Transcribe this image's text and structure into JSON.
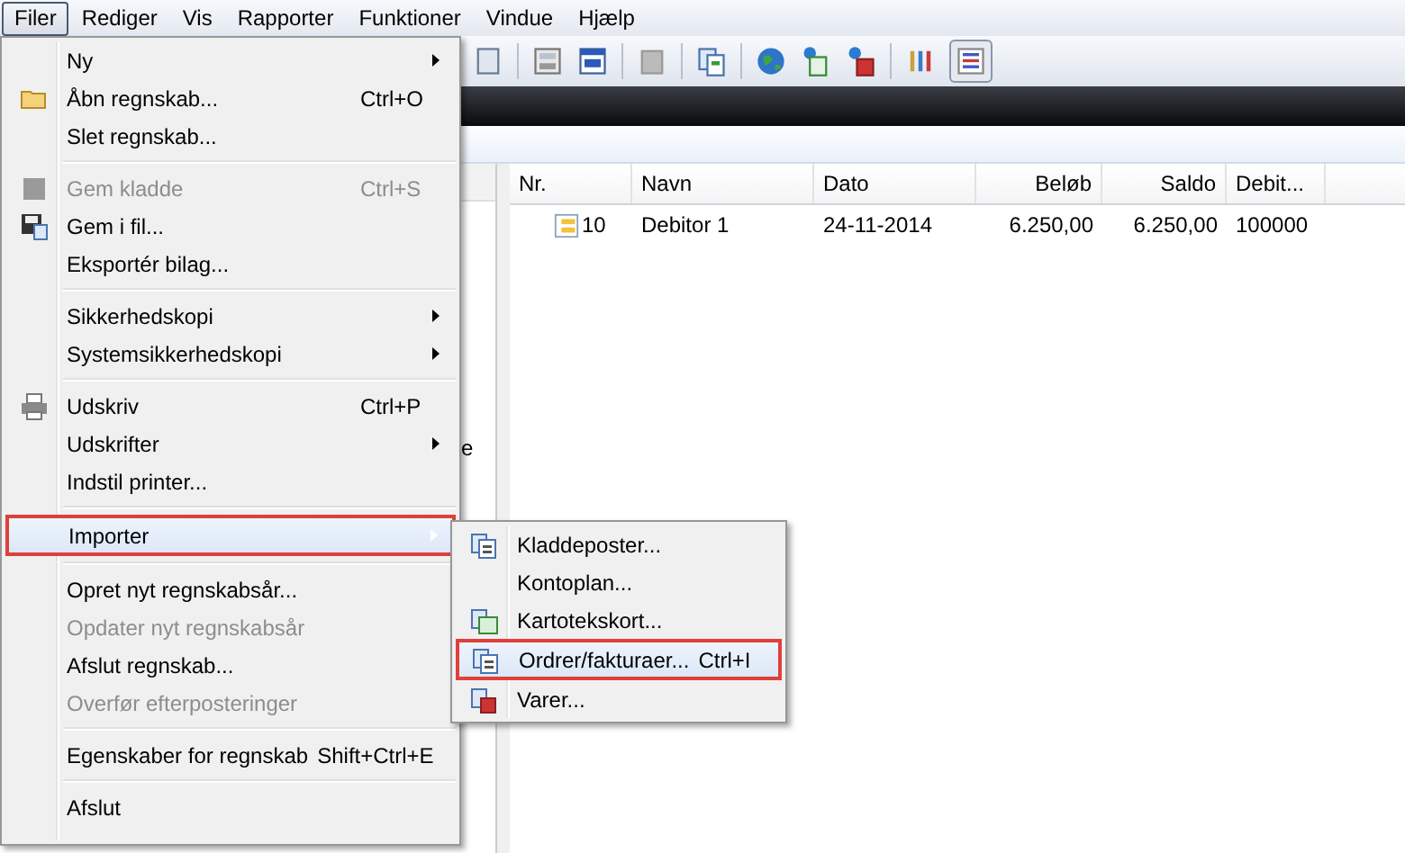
{
  "menu_bar": [
    {
      "label": "Filer",
      "selected": true
    },
    {
      "label": "Rediger",
      "selected": false
    },
    {
      "label": "Vis",
      "selected": false
    },
    {
      "label": "Rapporter",
      "selected": false
    },
    {
      "label": "Funktioner",
      "selected": false
    },
    {
      "label": "Vindue",
      "selected": false
    },
    {
      "label": "Hjælp",
      "selected": false
    }
  ],
  "table": {
    "columns": [
      {
        "label": "Nr."
      },
      {
        "label": "Navn"
      },
      {
        "label": "Dato"
      },
      {
        "label": "Beløb"
      },
      {
        "label": "Saldo"
      },
      {
        "label": "Debit..."
      }
    ],
    "rows": [
      [
        "10",
        "Debitor 1",
        "24-11-2014",
        "6.250,00",
        "6.250,00",
        "100000"
      ]
    ]
  },
  "left_pane": {
    "text_fragment": "e"
  },
  "file_menu": [
    {
      "kind": "item",
      "label": "Ny",
      "disabled": false,
      "submenu": true,
      "highlighted": false
    },
    {
      "kind": "item",
      "label": "Åbn regnskab...",
      "shortcut": "Ctrl+O",
      "disabled": false,
      "submenu": false,
      "highlighted": false
    },
    {
      "kind": "item",
      "label": "Slet regnskab...",
      "disabled": false,
      "submenu": false,
      "highlighted": false
    },
    {
      "kind": "separator"
    },
    {
      "kind": "item",
      "label": "Gem kladde",
      "shortcut": "Ctrl+S",
      "disabled": true,
      "submenu": false,
      "highlighted": false
    },
    {
      "kind": "item",
      "label": "Gem i fil...",
      "disabled": false,
      "submenu": false,
      "highlighted": false
    },
    {
      "kind": "item",
      "label": "Eksportér bilag...",
      "disabled": false,
      "submenu": false,
      "highlighted": false
    },
    {
      "kind": "separator"
    },
    {
      "kind": "item",
      "label": "Sikkerhedskopi",
      "disabled": false,
      "submenu": true,
      "highlighted": false
    },
    {
      "kind": "item",
      "label": "Systemsikkerhedskopi",
      "disabled": false,
      "submenu": true,
      "highlighted": false
    },
    {
      "kind": "separator"
    },
    {
      "kind": "item",
      "label": "Udskriv",
      "shortcut": "Ctrl+P",
      "disabled": false,
      "submenu": false,
      "highlighted": false
    },
    {
      "kind": "item",
      "label": "Udskrifter",
      "disabled": false,
      "submenu": true,
      "highlighted": false
    },
    {
      "kind": "item",
      "label": "Indstil printer...",
      "disabled": false,
      "submenu": false,
      "highlighted": false
    },
    {
      "kind": "separator"
    },
    {
      "kind": "item",
      "label": "Importer",
      "disabled": false,
      "submenu": true,
      "highlighted": true
    },
    {
      "kind": "separator"
    },
    {
      "kind": "item",
      "label": "Opret nyt regnskabsår...",
      "disabled": false,
      "submenu": false,
      "highlighted": false
    },
    {
      "kind": "item",
      "label": "Opdater nyt regnskabsår",
      "disabled": true,
      "submenu": false,
      "highlighted": false
    },
    {
      "kind": "item",
      "label": "Afslut regnskab...",
      "disabled": false,
      "submenu": false,
      "highlighted": false
    },
    {
      "kind": "item",
      "label": "Overfør efterposteringer",
      "disabled": true,
      "submenu": false,
      "highlighted": false
    },
    {
      "kind": "separator"
    },
    {
      "kind": "item",
      "label": "Egenskaber for regnskab",
      "shortcut": "Shift+Ctrl+E",
      "disabled": false,
      "submenu": false,
      "highlighted": false
    },
    {
      "kind": "separator"
    },
    {
      "kind": "item",
      "label": "Afslut",
      "disabled": false,
      "submenu": false,
      "highlighted": false
    }
  ],
  "import_submenu": [
    {
      "label": "Kladdeposter...",
      "highlighted": false
    },
    {
      "label": "Kontoplan...",
      "highlighted": false
    },
    {
      "label": "Kartotekskort...",
      "highlighted": false
    },
    {
      "label": "Ordrer/fakturaer...",
      "shortcut": "Ctrl+I",
      "highlighted": true
    },
    {
      "label": "Varer...",
      "highlighted": false
    }
  ]
}
